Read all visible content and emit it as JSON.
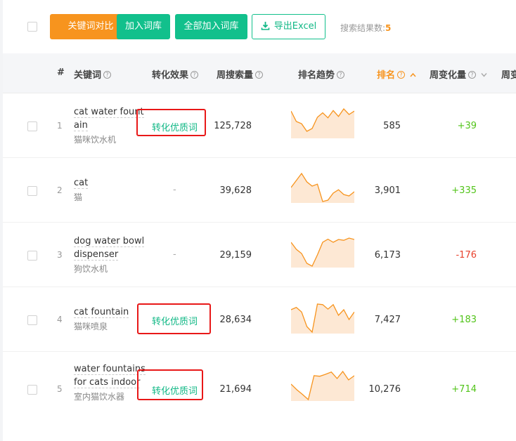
{
  "toolbar": {
    "compare_label": "关键词对比",
    "add_label": "加入词库",
    "add_all_label": "全部加入词库",
    "export_label": "导出Excel",
    "result_label": "搜索结果数:",
    "result_count": "5"
  },
  "columns": {
    "index": "#",
    "keyword": "关键词",
    "conversion": "转化效果",
    "weekly_volume": "周搜索量",
    "trend": "排名趋势",
    "rank": "排名",
    "weekly_change": "周变化量",
    "extra": "周变"
  },
  "rows": [
    {
      "index": "1",
      "keyword": "cat water fountain",
      "keyword_cn": "猫咪饮水机",
      "conversion": "转化优质词",
      "volume": "125,728",
      "rank": "585",
      "change": "+39",
      "trend": [
        0.92,
        0.55,
        0.47,
        0.2,
        0.3,
        0.7,
        0.86,
        0.68,
        0.94,
        0.73,
        1.0,
        0.8,
        0.92
      ]
    },
    {
      "index": "2",
      "keyword": "cat",
      "keyword_cn": "猫",
      "conversion": "-",
      "volume": "39,628",
      "rank": "3,901",
      "change": "+335",
      "trend": [
        0.5,
        0.75,
        1.0,
        0.7,
        0.55,
        0.62,
        0.0,
        0.05,
        0.3,
        0.42,
        0.25,
        0.2,
        0.35
      ]
    },
    {
      "index": "3",
      "keyword": "dog water bowl dispenser",
      "keyword_cn": "狗饮水机",
      "conversion": "-",
      "volume": "29,159",
      "rank": "6,173",
      "change": "-176",
      "trend": [
        0.85,
        0.6,
        0.45,
        0.1,
        0.0,
        0.4,
        0.85,
        0.96,
        0.85,
        0.95,
        0.92,
        1.0,
        0.95
      ]
    },
    {
      "index": "4",
      "keyword": "cat fountain",
      "keyword_cn": "猫咪喷泉",
      "conversion": "转化优质词",
      "volume": "28,634",
      "rank": "7,427",
      "change": "+183",
      "trend": [
        0.8,
        0.88,
        0.72,
        0.2,
        0.0,
        1.0,
        0.98,
        0.82,
        0.98,
        0.6,
        0.8,
        0.45,
        0.72
      ]
    },
    {
      "index": "5",
      "keyword": "water fountains for cats indoor",
      "keyword_cn": "室内猫饮水器",
      "conversion": "转化优质词",
      "volume": "21,694",
      "rank": "10,276",
      "change": "+714",
      "trend": [
        0.55,
        0.35,
        0.18,
        0.0,
        0.85,
        0.83,
        0.9,
        0.98,
        0.75,
        1.0,
        0.7,
        0.85
      ]
    }
  ],
  "colors": {
    "accent_orange": "#f7941e",
    "accent_green": "#12c08c",
    "positive": "#52c41a",
    "negative": "#e8412c",
    "highlight_box": "#e81818"
  }
}
